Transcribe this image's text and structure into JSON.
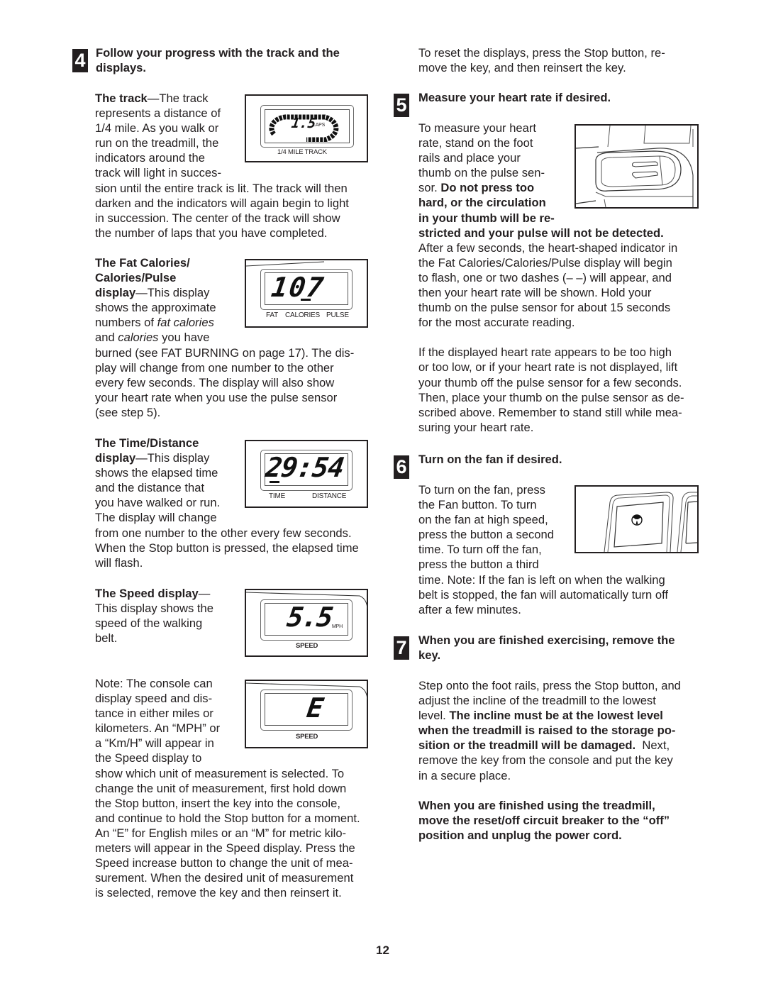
{
  "page_number": "12",
  "left": {
    "step4": {
      "number": "4",
      "title_line1": "Follow your progress with the track and the",
      "title_line2": "displays."
    },
    "track": {
      "heading": "The track",
      "lines_wrapped": [
        "—The track",
        "represents a distance of",
        "1/4 mile. As you walk or",
        "run on the treadmill, the",
        "indicators around the",
        "track will light in succes-"
      ],
      "lines_full": [
        "sion until the entire track is lit. The track will then",
        "darken and the indicators will again begin to light",
        "in succession. The center of the track will show",
        "the number of laps that you have completed."
      ],
      "figure": {
        "value": "1.5",
        "unit": "LAPS",
        "label": "1/4 MILE TRACK"
      }
    },
    "fat_calories": {
      "heading_line1": "The Fat Calories/",
      "heading_line2": "Calories/Pulse",
      "heading_line3": "display",
      "line3_rest": "—This display",
      "line4": "shows the approximate",
      "line5_pre": "numbers of ",
      "line5_em": "fat calories",
      "line6_pre": "and ",
      "line6_em": "calories",
      "line6_post": " you have",
      "lines_full": [
        "burned (see FAT BURNING on page 17). The dis-",
        "play will change from one number to the other",
        "every few seconds. The display will also show",
        "your heart rate when you use the pulse sensor",
        "(see step 5)."
      ],
      "figure": {
        "value": "107",
        "labels": [
          "FAT",
          "CALORIES",
          "PULSE"
        ]
      }
    },
    "time_distance": {
      "heading_line1": "The Time/Distance",
      "heading_line2": "display",
      "lines_wrapped": [
        "—This display",
        "shows the elapsed time",
        "and the distance that",
        "you have walked or run.",
        "The display will change"
      ],
      "lines_full": [
        "from one number to the other every few seconds.",
        "When the Stop button is pressed, the elapsed time",
        "will flash."
      ],
      "figure": {
        "value": "29:54",
        "labels": [
          "TIME",
          "DISTANCE"
        ]
      }
    },
    "speed": {
      "heading": "The Speed display",
      "heading_dash": "—",
      "lines_wrapped": [
        "This display shows the",
        "speed of the walking",
        "belt."
      ],
      "figure": {
        "value": "5.5",
        "unit": "MPH",
        "label": "SPEED"
      }
    },
    "note": {
      "lines_wrapped": [
        "Note: The console can",
        "display speed and dis-",
        "tance in either miles or",
        "kilometers. An “MPH” or",
        "a “Km/H” will appear in",
        "the Speed display to"
      ],
      "lines_full": [
        "show which unit of measurement is selected. To",
        "change the unit of measurement, first hold down",
        "the Stop button, insert the key into the console,",
        "and continue to hold the Stop button for a moment.",
        "An “E” for English miles or an “M” for metric kilo-",
        "meters will appear in the Speed display. Press the",
        "Speed increase button to change the unit of mea-",
        "surement. When the desired unit of measurement",
        "is selected, remove the key and then reinsert it."
      ],
      "figure": {
        "value": "E",
        "label": "SPEED"
      }
    }
  },
  "right": {
    "reset": [
      "To reset the displays, press the Stop button, re-",
      "move the key, and then reinsert the key."
    ],
    "step5": {
      "number": "5",
      "title": "Measure your heart rate if desired.",
      "lines_wrapped": [
        "To measure your heart",
        "rate, stand on the foot",
        "rails and place your",
        "thumb on the pulse sen-"
      ],
      "line5_pre": "sor. ",
      "line5_bold": "Do not press too",
      "bold_lines": [
        "hard, or the circulation",
        "in your thumb will be re-",
        "stricted and your pulse will not be detected."
      ],
      "lines_full": [
        "After a few seconds, the heart-shaped indicator in",
        "the Fat Calories/Calories/Pulse display will begin",
        "to flash, one or two dashes (– –) will appear, and",
        "then your heart rate will be shown. Hold your",
        "thumb on the pulse sensor for about 15 seconds",
        "for the most accurate reading."
      ],
      "para2": [
        "If the displayed heart rate appears to be too high",
        "or too low, or if your heart rate is not displayed, lift",
        "your thumb off the pulse sensor for a few seconds.",
        "Then, place your thumb on the pulse sensor as de-",
        "scribed above. Remember to stand still while mea-",
        "suring your heart rate."
      ]
    },
    "step6": {
      "number": "6",
      "title": "Turn on the fan if desired.",
      "lines_wrapped": [
        "To turn on the fan, press",
        "the Fan button. To turn",
        "on the fan at high speed,",
        "press the button a second",
        "time. To turn off the fan,",
        "press the button a third"
      ],
      "lines_full": [
        "time. Note: If the fan is left on when the walking",
        "belt is stopped, the fan will automatically turn off",
        "after a few minutes."
      ]
    },
    "step7": {
      "number": "7",
      "title_line1": "When you are finished exercising, remove the",
      "title_line2": "key.",
      "line1": "Step onto the foot rails, press the Stop button, and",
      "line2": "adjust the incline of the treadmill to the lowest",
      "line3_pre": "level. ",
      "line3_bold": "The incline must be at the lowest level",
      "line4_bold": "when the treadmill is raised to the storage po-",
      "line5_bold": "sition or the treadmill will be damaged.",
      "line5_post": "  Next,",
      "line6": "remove the key from the console and put the key",
      "line7": "in a secure place.",
      "final_bold": [
        "When you are finished using the treadmill,",
        "move the reset/off circuit breaker to the “off”",
        "position and unplug the power cord."
      ]
    }
  }
}
